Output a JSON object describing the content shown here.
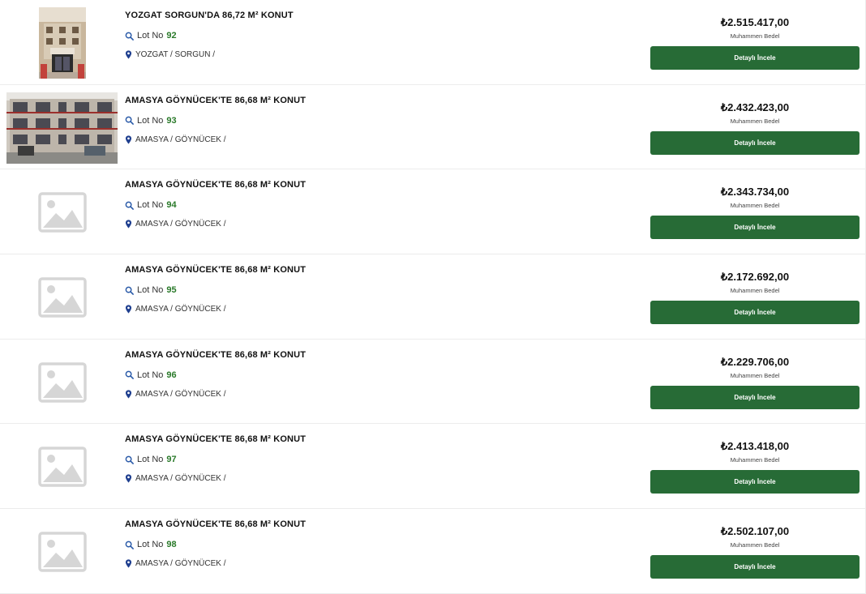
{
  "listings": [
    {
      "title": "YOZGAT SORGUN'DA 86,72 M² KONUT",
      "lot_label": "Lot No",
      "lot_no": "92",
      "location": "YOZGAT / SORGUN /",
      "price": "₺2.515.417,00",
      "price_label": "Muhammen Bedel",
      "button_label": "Detaylı İncele",
      "image": "building-photo-tall"
    },
    {
      "title": "AMASYA GÖYNÜCEK'TE 86,68 M² KONUT",
      "lot_label": "Lot No",
      "lot_no": "93",
      "location": "AMASYA / GÖYNÜCEK /",
      "price": "₺2.432.423,00",
      "price_label": "Muhammen Bedel",
      "button_label": "Detaylı İncele",
      "image": "building-photo-wide"
    },
    {
      "title": "AMASYA GÖYNÜCEK'TE 86,68 M² KONUT",
      "lot_label": "Lot No",
      "lot_no": "94",
      "location": "AMASYA / GÖYNÜCEK /",
      "price": "₺2.343.734,00",
      "price_label": "Muhammen Bedel",
      "button_label": "Detaylı İncele",
      "image": "image-placeholder-icon"
    },
    {
      "title": "AMASYA GÖYNÜCEK'TE 86,68 M² KONUT",
      "lot_label": "Lot No",
      "lot_no": "95",
      "location": "AMASYA / GÖYNÜCEK /",
      "price": "₺2.172.692,00",
      "price_label": "Muhammen Bedel",
      "button_label": "Detaylı İncele",
      "image": "image-placeholder-icon"
    },
    {
      "title": "AMASYA GÖYNÜCEK'TE 86,68 M² KONUT",
      "lot_label": "Lot No",
      "lot_no": "96",
      "location": "AMASYA / GÖYNÜCEK /",
      "price": "₺2.229.706,00",
      "price_label": "Muhammen Bedel",
      "button_label": "Detaylı İncele",
      "image": "image-placeholder-icon"
    },
    {
      "title": "AMASYA GÖYNÜCEK'TE 86,68 M² KONUT",
      "lot_label": "Lot No",
      "lot_no": "97",
      "location": "AMASYA / GÖYNÜCEK /",
      "price": "₺2.413.418,00",
      "price_label": "Muhammen Bedel",
      "button_label": "Detaylı İncele",
      "image": "image-placeholder-icon"
    },
    {
      "title": "AMASYA GÖYNÜCEK'TE 86,68 M² KONUT",
      "lot_label": "Lot No",
      "lot_no": "98",
      "location": "AMASYA / GÖYNÜCEK /",
      "price": "₺2.502.107,00",
      "price_label": "Muhammen Bedel",
      "button_label": "Detaylı İncele",
      "image": "image-placeholder-icon"
    }
  ],
  "colors": {
    "button_bg": "#276b36",
    "lot_number": "#2a7a2a",
    "location_pin": "#1f3f8f",
    "search_icon": "#2a5aa8",
    "placeholder_icon": "#d6d6d6"
  }
}
